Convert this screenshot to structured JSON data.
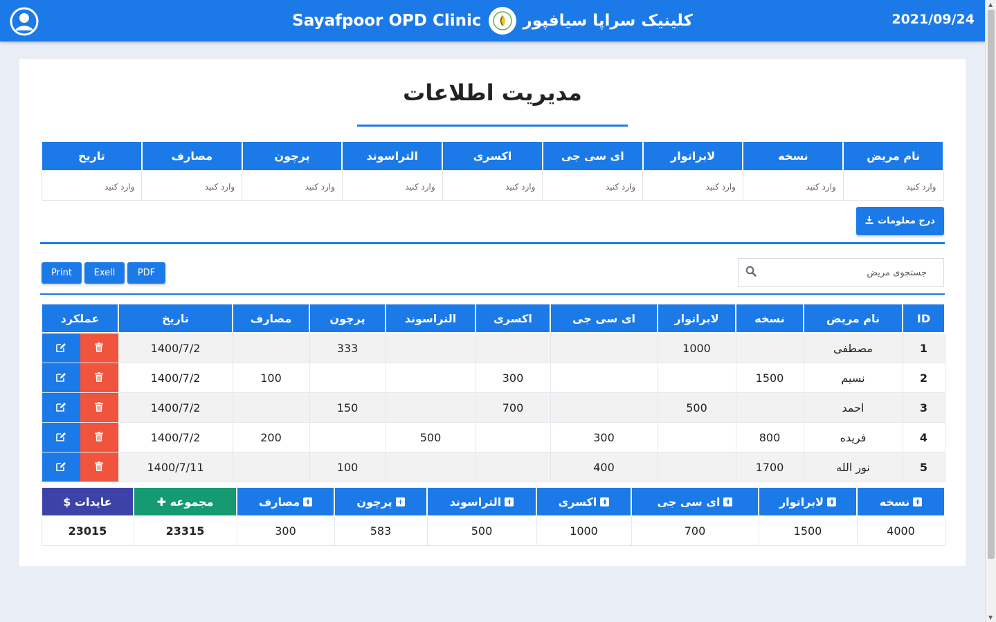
{
  "header": {
    "title_en": "Sayafpoor OPD Clinic",
    "title_fa": "کلینیک سراپا سیافپور",
    "date": "2021/09/24"
  },
  "page": {
    "title": "مدیریت اطلاعات"
  },
  "input_form": {
    "headers": [
      "نام مریض",
      "نسخه",
      "لابراتوار",
      "ای سی جی",
      "اکسری",
      "التراسوند",
      "پرچون",
      "مصارف",
      "تاریخ"
    ],
    "placeholder": "وارد کنید",
    "submit_label": "درج معلومات"
  },
  "search": {
    "placeholder": "جستجوی مریض"
  },
  "export": {
    "pdf": "PDF",
    "excel": "Exell",
    "print": "Print"
  },
  "table": {
    "headers": [
      "ID",
      "نام مریض",
      "نسخه",
      "لابراتوار",
      "ای سی جی",
      "اکسری",
      "التراسوند",
      "پرچون",
      "مصارف",
      "تاریخ",
      "عملکرد"
    ],
    "rows": [
      [
        "1",
        "مصطفی",
        "",
        "1000",
        "",
        "",
        "",
        "333",
        "",
        "1400/7/2"
      ],
      [
        "2",
        "نسیم",
        "1500",
        "",
        "",
        "300",
        "",
        "",
        "100",
        "1400/7/2"
      ],
      [
        "3",
        "احمد",
        "",
        "500",
        "",
        "700",
        "",
        "150",
        "",
        "1400/7/2"
      ],
      [
        "4",
        "فریده",
        "800",
        "",
        "300",
        "",
        "500",
        "",
        "200",
        "1400/7/2"
      ],
      [
        "5",
        "نور الله",
        "1700",
        "",
        "400",
        "",
        "",
        "100",
        "",
        "1400/7/11"
      ]
    ]
  },
  "summary": {
    "headers": [
      "نسخه",
      "لابراتوار",
      "ای سی جی",
      "اکسری",
      "التراسوند",
      "پرچون",
      "مصارف",
      "مجموعه",
      "عایدات $"
    ],
    "values": [
      "4000",
      "1500",
      "700",
      "1000",
      "500",
      "583",
      "300",
      "23315",
      "23015"
    ]
  },
  "colors": {
    "primary": "#1c7ae8",
    "danger": "#f0543c",
    "success": "#159a72",
    "indigo": "#3d42a8"
  }
}
